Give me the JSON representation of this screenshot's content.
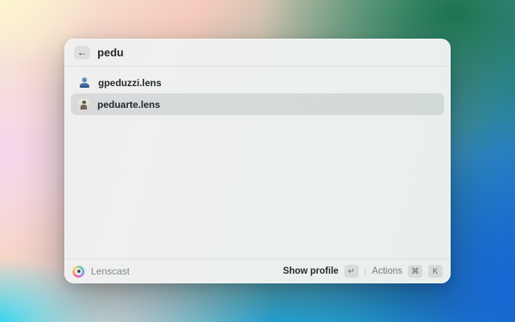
{
  "colors": {
    "selected_row_bg": "#d4dadb",
    "window_bg": "#edf0ef",
    "avatar_placeholder_blue": "#4580b4",
    "wallpaper_corners": [
      "#fdf4cd",
      "#1a6e49",
      "#1463d2",
      "#22d3ec"
    ]
  },
  "window": {
    "search": {
      "back_icon": "←",
      "query": "pedu"
    },
    "results": {
      "items": [
        {
          "icon": "person-avatar-placeholder",
          "label": "gpeduzzi.lens",
          "selected": false
        },
        {
          "icon": "photo-avatar",
          "label": "peduarte.lens",
          "selected": true
        }
      ]
    },
    "footer": {
      "logo_icon": "lens-rings",
      "app_name": "Lenscast",
      "primary_action": {
        "label": "Show profile",
        "key": "↵"
      },
      "separator": "|",
      "secondary_action": {
        "label": "Actions",
        "keys": [
          "⌘",
          "K"
        ]
      }
    }
  }
}
